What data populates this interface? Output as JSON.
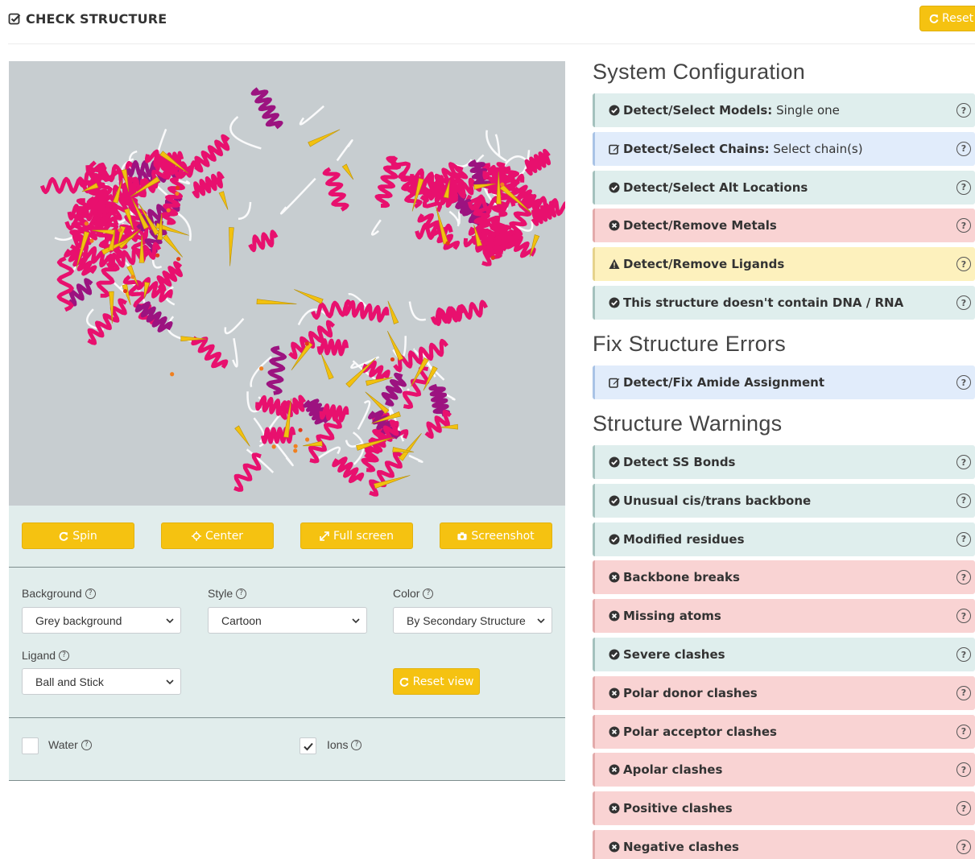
{
  "header": {
    "title": "CHECK STRUCTURE",
    "reset_label": "Reset"
  },
  "viewer": {
    "buttons": {
      "spin": "Spin",
      "center": "Center",
      "fullscreen": "Full screen",
      "screenshot": "Screenshot"
    },
    "background": {
      "label": "Background",
      "value": "Grey background"
    },
    "style": {
      "label": "Style",
      "value": "Cartoon"
    },
    "color": {
      "label": "Color",
      "value": "By Secondary Structure"
    },
    "ligand": {
      "label": "Ligand",
      "value": "Ball and Stick"
    },
    "reset_view": "Reset view",
    "water": {
      "label": "Water",
      "checked": false
    },
    "ions": {
      "label": "Ions",
      "checked": true
    }
  },
  "sections": {
    "config_title": "System Configuration",
    "fix_title": "Fix Structure Errors",
    "warn_title": "Structure Warnings"
  },
  "config_items": [
    {
      "bold": "Detect/Select Models:",
      "rest": " Single one",
      "status": "ok"
    },
    {
      "bold": "Detect/Select Chains:",
      "rest": " Select chain(s)",
      "status": "info"
    },
    {
      "bold": "Detect/Select Alt Locations",
      "rest": "",
      "status": "ok"
    },
    {
      "bold": "Detect/Remove Metals",
      "rest": "",
      "status": "err"
    },
    {
      "bold": "Detect/Remove Ligands",
      "rest": "",
      "status": "warn"
    },
    {
      "bold": "This structure doesn't contain DNA / RNA",
      "rest": "",
      "status": "ok"
    }
  ],
  "fix_items": [
    {
      "bold": "Detect/Fix Amide Assignment",
      "rest": "",
      "status": "info"
    }
  ],
  "warning_items": [
    {
      "bold": "Detect SS Bonds",
      "rest": "",
      "status": "ok"
    },
    {
      "bold": "Unusual cis/trans backbone",
      "rest": "",
      "status": "ok"
    },
    {
      "bold": "Modified residues",
      "rest": "",
      "status": "ok"
    },
    {
      "bold": "Backbone breaks",
      "rest": "",
      "status": "err"
    },
    {
      "bold": "Missing atoms",
      "rest": "",
      "status": "err"
    },
    {
      "bold": "Severe clashes",
      "rest": "",
      "status": "ok"
    },
    {
      "bold": "Polar donor clashes",
      "rest": "",
      "status": "err"
    },
    {
      "bold": "Polar acceptor clashes",
      "rest": "",
      "status": "err"
    },
    {
      "bold": "Apolar clashes",
      "rest": "",
      "status": "err"
    },
    {
      "bold": "Positive clashes",
      "rest": "",
      "status": "err"
    },
    {
      "bold": "Negative clashes",
      "rest": "",
      "status": "err"
    }
  ],
  "colors": {
    "accent": "#f5c211",
    "ok_bg": "#dfeeed",
    "info_bg": "#e1ecfb",
    "err_bg": "#f9d3d3",
    "warn_bg": "#fdf1bd",
    "helix": "#e8106e",
    "sheet": "#f2c10f",
    "coil": "#ffffff",
    "viewer_bg": "#c7cdd0"
  },
  "help_glyph": "?"
}
